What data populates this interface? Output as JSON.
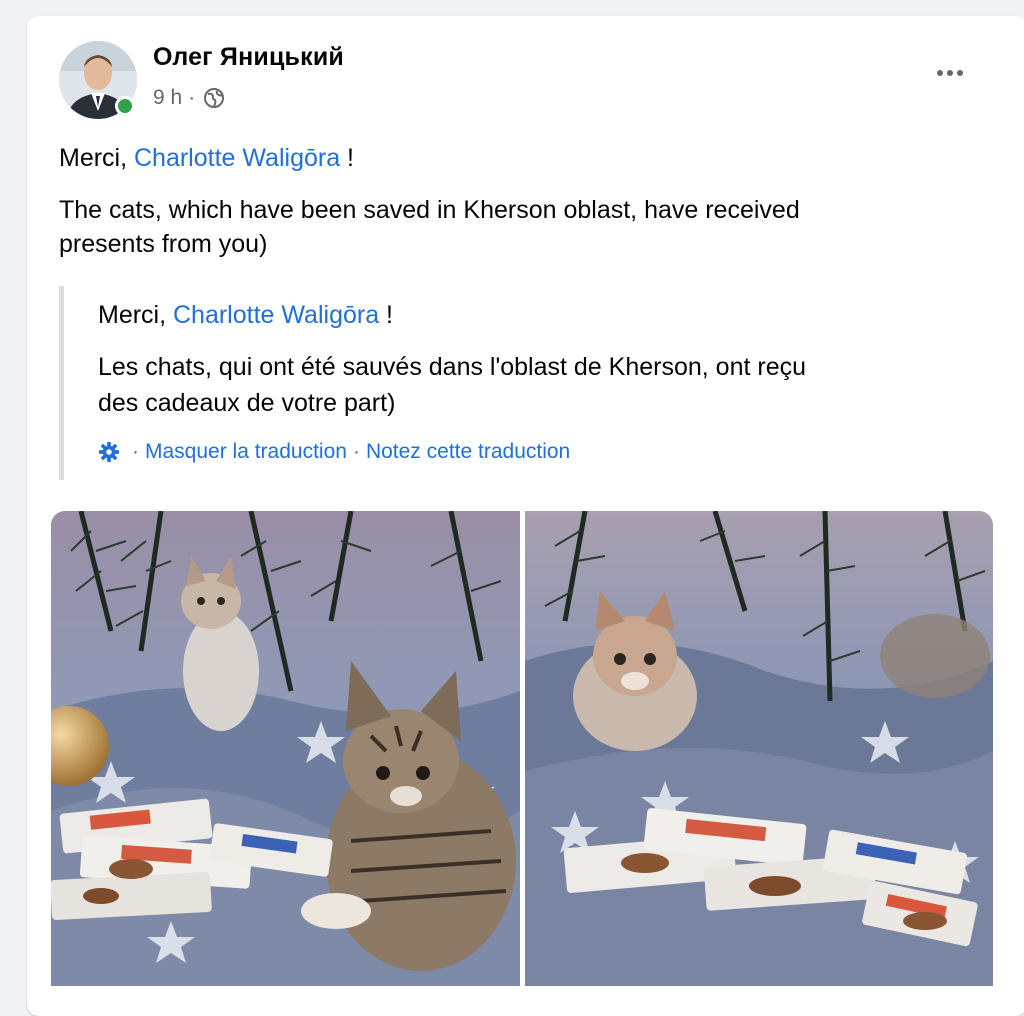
{
  "post": {
    "author_name": "Олег Яницький",
    "time": "9 h",
    "separator": "·",
    "privacy_icon": "globe-icon",
    "more_icon": "more-options-icon",
    "online": true,
    "body": {
      "greeting_prefix": "Merci, ",
      "mention": "Charlotte Waligōra",
      "greeting_suffix": " !",
      "line1": "The cats, which have been saved in Kherson oblast, have received",
      "line2": "presents from you)"
    },
    "translation": {
      "greeting_prefix": "Merci, ",
      "mention": "Charlotte Waligōra",
      "greeting_suffix": " !",
      "line1": "Les chats, qui ont été sauvés dans l'oblast de Kherson, ont reçu",
      "line2": "des cadeaux de votre part)",
      "settings_icon": "gear-icon",
      "hide_label": "Masquer la traduction",
      "rate_label": "Notez cette traduction",
      "separator": "·"
    },
    "photos": [
      {
        "subject": "tabby kitten and calico kitten under christmas tree with treat packets"
      },
      {
        "subject": "fluffy calico kitten under christmas tree with treat packets"
      }
    ]
  },
  "colors": {
    "link": "#216fdb",
    "secondary_text": "#65676b",
    "online": "#31a24c",
    "quote_bar": "#dadde1"
  }
}
